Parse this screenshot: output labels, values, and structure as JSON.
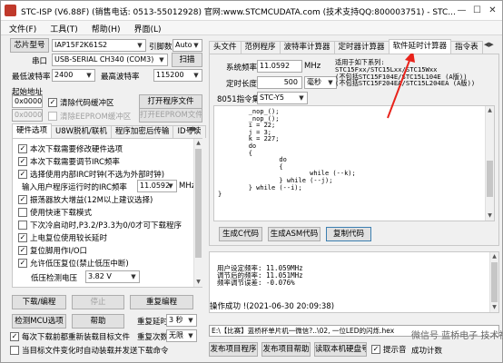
{
  "window": {
    "title": "STC-ISP (V6.88F) (销售电话: 0513-55012928) 官网:www.STCMCUDATA.com (技术支持QQ:800003751) - STC...",
    "min": "—",
    "max": "☐",
    "close": "✕"
  },
  "menu": [
    "文件(F)",
    "工具(T)",
    "帮助(H)",
    "界面(L)"
  ],
  "left": {
    "chip_label": "芯片型号",
    "chip_value": "IAP15F2K61S2",
    "pins_label": "引脚数",
    "pins_value": "Auto",
    "port_label": "串口",
    "port_value": "USB-SERIAL CH340 (COM3)",
    "scan_btn": "扫描",
    "minbaud_label": "最低波特率",
    "minbaud_value": "2400",
    "maxbaud_label": "最高波特率",
    "maxbaud_value": "115200",
    "start_addr_label": "起始地址",
    "addr1": "0x0000",
    "clear_code_label": "清除代码缓冲区",
    "open_prog_btn": "打开程序文件",
    "addr2": "0x0000",
    "clear_eeprom_label": "清除EEPROM缓冲区",
    "open_eeprom_btn": "打开EEPROM文件",
    "option_tabs": [
      "硬件选项",
      "U8W脱机/联机",
      "程序加密后传输",
      "ID号读"
    ],
    "options": [
      {
        "label": "本次下载需要修改硬件选项",
        "checked": true
      },
      {
        "label": "本次下载需要调节IRC频率",
        "checked": true
      },
      {
        "label": "选择使用内部IRC时钟(不选为外部时钟)",
        "checked": true
      },
      {
        "label": "输入用户程序运行时的IRC频率",
        "value": "11.0592",
        "unit": "MHz"
      },
      {
        "label": "振荡器放大增益(12M以上建议选择)",
        "checked": true
      },
      {
        "label": "使用快速下载模式",
        "checked": false
      },
      {
        "label": "下次冷启动时,P3.2/P3.3为0/0才可下载程序",
        "checked": false
      },
      {
        "label": "上电复位使用较长延时",
        "checked": true
      },
      {
        "label": "复位脚用作I/O口",
        "checked": true
      },
      {
        "label": "允许低压复位(禁止低压中断)",
        "checked": true
      },
      {
        "label": "低压检测电压",
        "value": "3.82 V"
      }
    ],
    "download_btn": "下载/编程",
    "stop_btn": "停止",
    "reprog_btn": "重复编程",
    "detect_btn": "检测MCU选项",
    "help_btn": "帮助",
    "redelay_label": "重复延时",
    "redelay_value": "3 秒",
    "recount_label": "重复次数",
    "recount_value": "无限",
    "reload_label": "每次下载前都重新装载目标文件",
    "autoload_label": "当目标文件变化时自动装载并发送下载命令"
  },
  "right": {
    "tabs": [
      "头文件",
      "范例程序",
      "波特率计算器",
      "定时器计算器",
      "软件延时计算器",
      "指令表"
    ],
    "active_tab": "软件延时计算器",
    "freq_label": "系统频率",
    "freq_value": "11.0592",
    "freq_unit": "MHz",
    "delay_label": "定时长度",
    "delay_value": "500",
    "delay_unit": "毫秒",
    "isa_label": "8051指令集",
    "isa_value": "STC-Y5",
    "note": "适用于如下系列:\nSTC15Fxx/STC15Lxx/STC15Wxx\n(不包括STC15F104E/STC15L104E (A版))\n(不包括STC15F204EA/STC15L204EA (A版))",
    "code": "        _nop_();\n        _nop_();\n        i = 22;\n        j = 3;\n        k = 227;\n        do\n        {\n                do\n                {\n                        while (--k);\n                } while (--j);\n        } while (--i);\n}",
    "gen_c_btn": "生成C代码",
    "gen_asm_btn": "生成ASM代码",
    "copy_btn": "复制代码"
  },
  "output": {
    "lines": [
      "用户设定频率: 11.059MHz",
      "调节后的频率: 11.051MHz",
      "频率调节误差: -0.076%"
    ],
    "status": "操作成功 !(2021-06-30 20:09:38)"
  },
  "bottom": {
    "file_path": "E:\\【比赛】蓝桥杯单片机一微信?..\\02, 一位LED的闪烁.hex",
    "publish_prog_btn": "发布项目程序",
    "publish_help_btn": "发布项目帮助",
    "read_serial_btn": "读取本机硬盘号",
    "sound_label": "提示音",
    "success_count_label": "成功计数"
  },
  "watermark": "微信号 蓝桥电子 技术社区"
}
